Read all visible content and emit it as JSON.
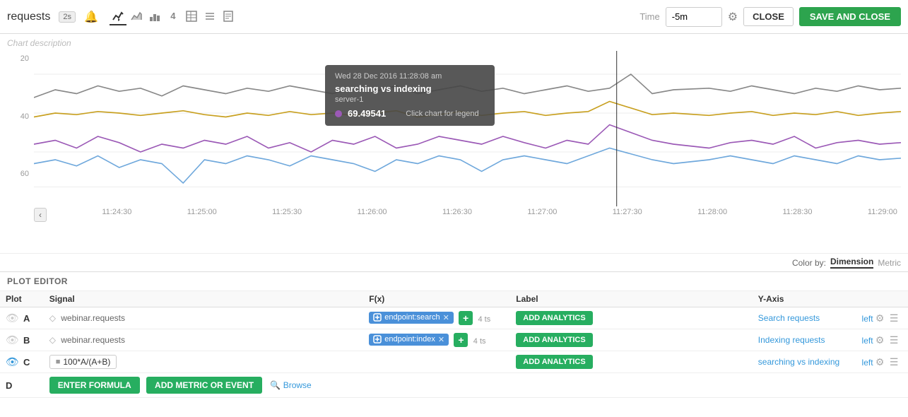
{
  "header": {
    "title": "requests",
    "badge": "2s",
    "time_label": "Time",
    "time_value": "-5m",
    "close_label": "CLOSE",
    "save_close_label": "SAVE AND CLOSE"
  },
  "chart": {
    "description": "Chart description",
    "y_labels": [
      "20",
      "40",
      "60"
    ],
    "x_labels": [
      "11:24:30",
      "11:25:00",
      "11:25:30",
      "11:26:00",
      "11:26:30",
      "11:27:00",
      "11:27:30",
      "11:28:00",
      "11:28:30",
      "11:29:00"
    ],
    "tooltip": {
      "time": "Wed 28 Dec 2016 11:28:08 am",
      "title": "searching vs indexing",
      "subtitle": "server-1",
      "value": "69.49541",
      "hint": "Click chart for legend"
    },
    "color_by_label": "Color by:",
    "color_by_options": [
      "Dimension",
      "Metric"
    ]
  },
  "plot_editor": {
    "title": "PLOT EDITOR",
    "columns": [
      "Plot",
      "Signal",
      "F(x)",
      "Label",
      "Y-Axis"
    ],
    "rows": [
      {
        "id": "A",
        "eye": "faded",
        "signal": "webinar.requests",
        "tag": "endpoint:search",
        "ts": "4 ts",
        "label": "Search requests",
        "yaxis": "left"
      },
      {
        "id": "B",
        "eye": "faded",
        "signal": "webinar.requests",
        "tag": "endpoint:index",
        "ts": "4 ts",
        "label": "Indexing requests",
        "yaxis": "left"
      },
      {
        "id": "C",
        "eye": "active",
        "signal": null,
        "formula": "100*A/(A+B)",
        "ts": null,
        "label": "searching vs indexing",
        "yaxis": "left"
      }
    ],
    "row_d": {
      "id": "D",
      "enter_formula_label": "ENTER FORMULA",
      "add_metric_label": "ADD METRIC OR EVENT",
      "browse_label": "Browse"
    }
  }
}
